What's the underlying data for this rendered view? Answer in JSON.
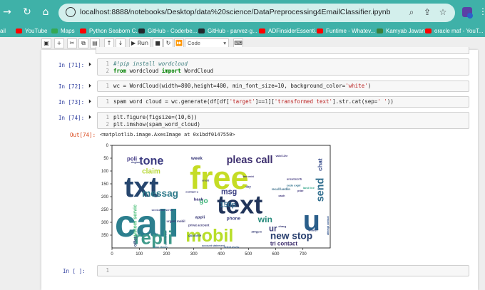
{
  "browser": {
    "url": "localhost:8888/notebooks/Desktop/data%20science/DataPreprocessing4EmailClassifier.ipynb",
    "bookmarks": [
      {
        "label": "ail",
        "color": "#d93025"
      },
      {
        "label": "YouTube",
        "color": "#ff0000"
      },
      {
        "label": "Maps",
        "color": "#34a853"
      },
      {
        "label": "Python Seaborn C...",
        "color": "#ff0000"
      },
      {
        "label": "GitHub - Coderbe...",
        "color": "#24292e"
      },
      {
        "label": "GitHub - parvez-g...",
        "color": "#24292e"
      },
      {
        "label": "ADFinsiderEssenti...",
        "color": "#ff0000"
      },
      {
        "label": "Funtime - Whatev...",
        "color": "#ff0000"
      },
      {
        "label": "Kamyab Jawan",
        "color": "#3b7f3b"
      },
      {
        "label": "oracle maf - YouT...",
        "color": "#ff0000"
      }
    ]
  },
  "toolbar": {
    "run_label": "Run",
    "cell_type": "Code"
  },
  "cells": [
    {
      "prompt": "In [71]:",
      "lines": [
        {
          "num": "1",
          "parts": [
            {
              "cls": "c",
              "text": "#!pip install wordcloud"
            }
          ]
        },
        {
          "num": "2",
          "parts": [
            {
              "cls": "k",
              "text": "from "
            },
            {
              "cls": "t",
              "text": "wordcloud "
            },
            {
              "cls": "k",
              "text": "import "
            },
            {
              "cls": "t",
              "text": "WordCloud"
            }
          ]
        }
      ]
    },
    {
      "prompt": "In [72]:",
      "lines": [
        {
          "num": "1",
          "parts": [
            {
              "cls": "t",
              "text": "wc = WordCloud(width=800,height=400, min_font_size=10, background_color="
            },
            {
              "cls": "s",
              "text": "'white'"
            },
            {
              "cls": "t",
              "text": ")"
            }
          ]
        }
      ]
    },
    {
      "prompt": "In [73]:",
      "lines": [
        {
          "num": "1",
          "parts": [
            {
              "cls": "t",
              "text": "spam word cloud = wc.generate(df[df["
            },
            {
              "cls": "s",
              "text": "'target'"
            },
            {
              "cls": "t",
              "text": "]=="
            },
            {
              "cls": "n",
              "text": "1"
            },
            {
              "cls": "t",
              "text": "]["
            },
            {
              "cls": "s",
              "text": "'transformed text'"
            },
            {
              "cls": "t",
              "text": "].str.cat(sep="
            },
            {
              "cls": "s",
              "text": "' '"
            },
            {
              "cls": "t",
              "text": "))"
            }
          ]
        }
      ]
    },
    {
      "prompt": "In [74]:",
      "lines": [
        {
          "num": "1",
          "parts": [
            {
              "cls": "t",
              "text": "plt.figure(figsize=(10,6))"
            }
          ]
        },
        {
          "num": "2",
          "parts": [
            {
              "cls": "t",
              "text": "plt.imshow(spam_word_cloud)"
            }
          ]
        }
      ]
    },
    {
      "prompt": "In [ ]:",
      "lines": [
        {
          "num": "1",
          "parts": []
        }
      ]
    }
  ],
  "output": {
    "prompt": "Out[74]:",
    "text": "<matplotlib.image.AxesImage at 0x1bdf0147550>"
  },
  "wordcloud": {
    "x_ticks": [
      "0",
      "100",
      "200",
      "300",
      "400",
      "500",
      "600",
      "700"
    ],
    "y_ticks": [
      "0",
      "50",
      "100",
      "150",
      "200",
      "250",
      "300",
      "350"
    ],
    "words": [
      {
        "text": "call",
        "color": "#2c7f8e"
      },
      {
        "text": "free",
        "color": "#c5dc25"
      },
      {
        "text": "txt",
        "color": "#26466e"
      },
      {
        "text": "text",
        "color": "#21345a"
      },
      {
        "text": "u",
        "color": "#2a5e8a"
      },
      {
        "text": "mobil",
        "color": "#b8de29"
      },
      {
        "text": "repli",
        "color": "#3e9a8a"
      },
      {
        "text": "tone",
        "color": "#3a3a80"
      },
      {
        "text": "pleas call",
        "color": "#3c2e6e"
      },
      {
        "text": "send",
        "color": "#306e8e"
      },
      {
        "text": "chat",
        "color": "#3a4e8c"
      },
      {
        "text": "claim",
        "color": "#b8d838"
      },
      {
        "text": "messag",
        "color": "#2e7a8a"
      },
      {
        "text": "msg",
        "color": "#3a3e82"
      },
      {
        "text": "150p",
        "color": "#2f6a8c"
      },
      {
        "text": "win",
        "color": "#2a8c7e"
      },
      {
        "text": "ur",
        "color": "#3b3e7a"
      },
      {
        "text": "new stop",
        "color": "#273e6e"
      },
      {
        "text": "tri contact",
        "color": "#3b2b6a"
      },
      {
        "text": "poli",
        "color": "#3a3080"
      },
      {
        "text": "week",
        "color": "#3a3a7a"
      },
      {
        "text": "go",
        "color": "#41b67a"
      },
      {
        "text": "custom servic",
        "color": "#4ec07a"
      },
      {
        "text": "offer",
        "color": "#3a5080"
      },
      {
        "text": "phone",
        "color": "#3a4080"
      },
      {
        "text": "privat account",
        "color": "#3e3a78"
      },
      {
        "text": "urgent mobil",
        "color": "#3d3a78"
      },
      {
        "text": "appli",
        "color": "#3a3a78"
      },
      {
        "text": "back",
        "color": "#3a3078"
      },
      {
        "text": "day",
        "color": "#3a4080"
      },
      {
        "text": "150ppm",
        "color": "#3a4078"
      },
      {
        "text": "unsubscrib",
        "color": "#3a3078"
      },
      {
        "text": "code expir",
        "color": "#2a6e8a"
      },
      {
        "text": "land line",
        "color": "#35a78a"
      },
      {
        "text": "prize",
        "color": "#3a3078"
      },
      {
        "text": "guarante",
        "color": "#2a4e8a"
      },
      {
        "text": "account statement",
        "color": "#3a5080"
      },
      {
        "text": "select receiv",
        "color": "#2a5080"
      },
      {
        "text": "draw shows",
        "color": "#3a6e8a"
      },
      {
        "text": "winner",
        "color": "#2a3e7a"
      },
      {
        "text": "camcorder",
        "color": "#2a6e8a"
      },
      {
        "text": "rington",
        "color": "#3a4080"
      },
      {
        "text": "servicemte servic",
        "color": "#3a4080"
      },
      {
        "text": "credit",
        "color": "#3a4080"
      },
      {
        "text": "contact u",
        "color": "#3a3a78"
      },
      {
        "text": "recall landlin",
        "color": "#3a6e8a"
      },
      {
        "text": "charg",
        "color": "#3a3a78"
      },
      {
        "text": "attempt contact",
        "color": "#2a4e8a"
      },
      {
        "text": "free entri",
        "color": "#3a3078"
      },
      {
        "text": "valid 12hr",
        "color": "#3a3078"
      },
      {
        "text": "cash",
        "color": "#3a3078"
      }
    ]
  }
}
